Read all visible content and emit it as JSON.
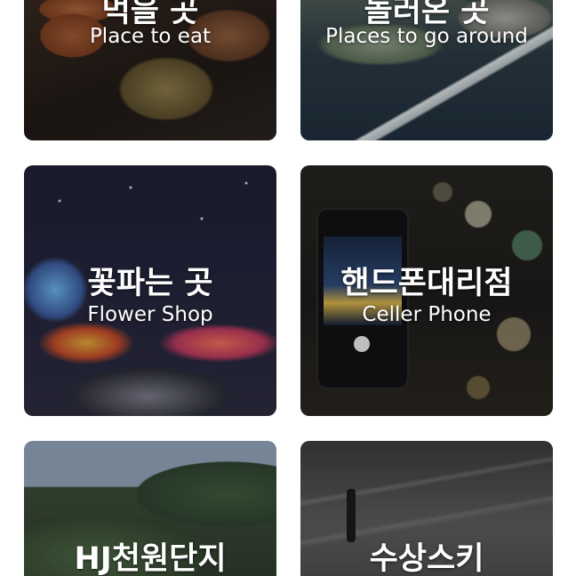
{
  "cards": [
    {
      "title_ko": "먹을 곳",
      "title_en": "Place to eat"
    },
    {
      "title_ko": "놀러온 곳",
      "title_en": "Places to go around"
    },
    {
      "title_ko": "꽃파는 곳",
      "title_en": "Flower Shop"
    },
    {
      "title_ko": "핸드폰대리점",
      "title_en": "Celler Phone"
    },
    {
      "title_ko": "HJ천원단지"
    },
    {
      "title_ko": "수상스키"
    }
  ]
}
